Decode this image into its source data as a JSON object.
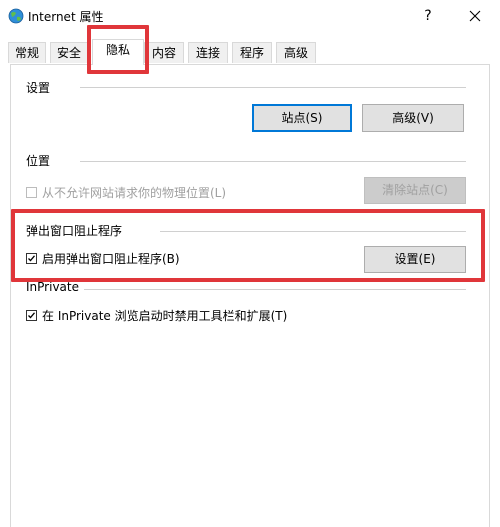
{
  "window": {
    "title": "Internet 属性",
    "help_label": "?",
    "icon": "internet-globe-icon"
  },
  "tabs": [
    {
      "label": "常规",
      "active": false
    },
    {
      "label": "安全",
      "active": false
    },
    {
      "label": "隐私",
      "active": true
    },
    {
      "label": "内容",
      "active": false
    },
    {
      "label": "连接",
      "active": false
    },
    {
      "label": "程序",
      "active": false
    },
    {
      "label": "高级",
      "active": false
    }
  ],
  "settings_group": {
    "heading": "设置",
    "sites_button": "站点(S)",
    "advanced_button": "高级(V)"
  },
  "location_group": {
    "heading": "位置",
    "never_allow_label": "从不允许网站请求你的物理位置(L)",
    "never_allow_checked": false,
    "clear_sites_button": "清除站点(C)"
  },
  "popup_group": {
    "heading": "弹出窗口阻止程序",
    "enable_label": "启用弹出窗口阻止程序(B)",
    "enable_checked": true,
    "settings_button": "设置(E)"
  },
  "inprivate_group": {
    "heading": "InPrivate",
    "disable_toolbars_label": "在 InPrivate 浏览启动时禁用工具栏和扩展(T)",
    "disable_toolbars_checked": true
  },
  "colors": {
    "highlight": "#e0363a",
    "default_button_border": "#0078d7"
  }
}
